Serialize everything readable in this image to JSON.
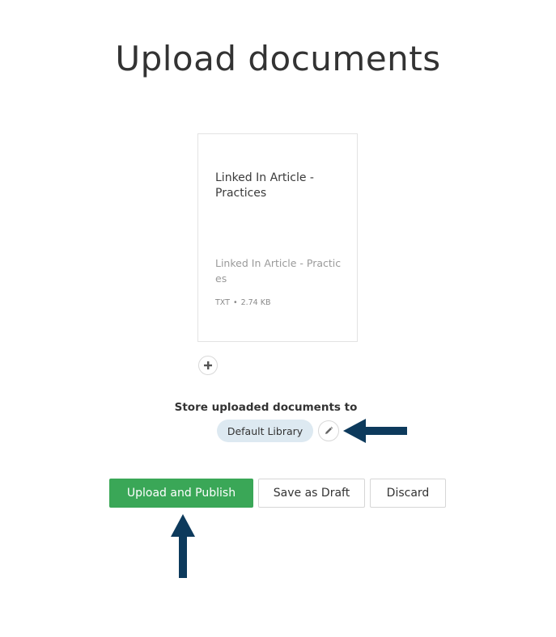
{
  "page": {
    "title": "Upload documents"
  },
  "document": {
    "title": "Linked In Article - Practices",
    "filename": "Linked In Article - Practices",
    "type": "TXT",
    "separator": "•",
    "size": "2.74 KB"
  },
  "add_button": {
    "icon": "plus-icon"
  },
  "storage": {
    "label": "Store uploaded documents to",
    "library": "Default Library",
    "edit_icon": "pencil-icon"
  },
  "actions": {
    "upload_publish": "Upload and Publish",
    "save_draft": "Save as Draft",
    "discard": "Discard"
  },
  "colors": {
    "primary": "#3aa757",
    "pill_background": "#dde9f1",
    "annotation_arrow": "#0d3a5c"
  }
}
